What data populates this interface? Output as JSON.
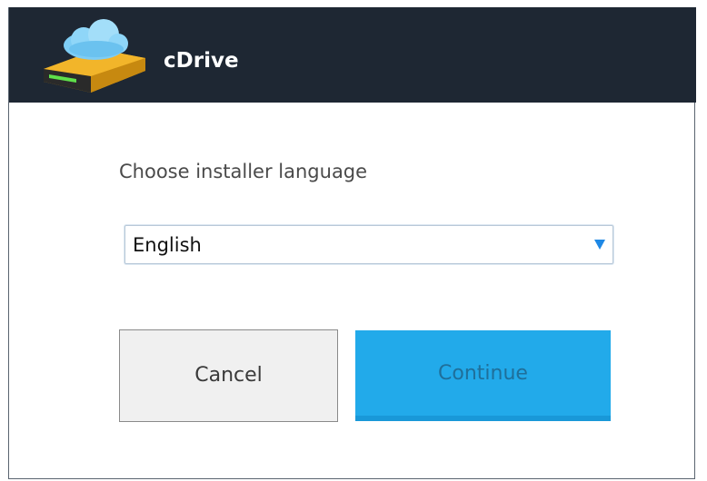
{
  "window": {
    "title": "cDrive",
    "logo_icon": "cloud-drive-logo-icon"
  },
  "main": {
    "prompt": "Choose installer language",
    "language_select": {
      "selected": "English",
      "arrow_icon": "chevron-down-icon"
    },
    "cancel_label": "Cancel",
    "continue_label": "Continue"
  },
  "colors": {
    "titlebar": "#1e2733",
    "accent": "#22aaea",
    "arrow": "#1e88e5"
  }
}
